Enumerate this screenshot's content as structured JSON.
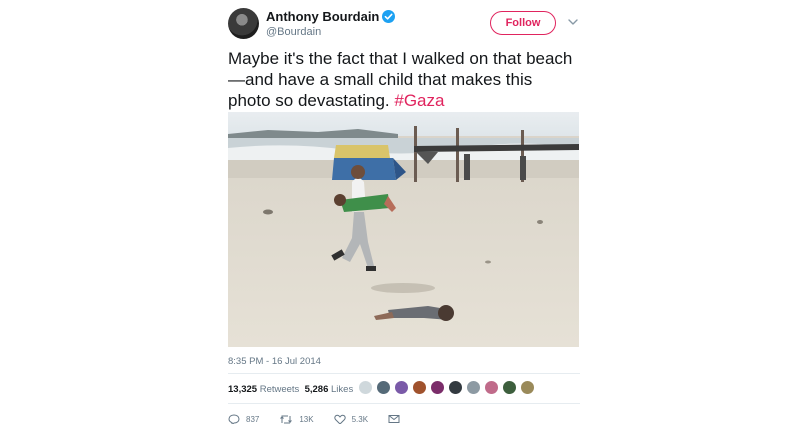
{
  "user": {
    "name": "Anthony Bourdain",
    "handle": "@Bourdain"
  },
  "follow_label": "Follow",
  "tweet": {
    "text": "Maybe it's the fact that I walked on that beach—and have a small child that makes this photo so devastating.",
    "hashtag": "#Gaza"
  },
  "timestamp": "8:35 PM - 16 Jul 2014",
  "stats": {
    "retweets_count": "13,325",
    "retweets_label": "Retweets",
    "likes_count": "5,286",
    "likes_label": "Likes"
  },
  "actions": {
    "replies": "837",
    "retweets": "13K",
    "likes": "5.3K"
  },
  "colors": {
    "accent": "#e0245e",
    "verified": "#1da1f2",
    "muted": "#657786"
  },
  "icons": {
    "reply": "reply-icon",
    "retweet": "retweet-icon",
    "like": "heart-icon",
    "message": "envelope-icon"
  }
}
